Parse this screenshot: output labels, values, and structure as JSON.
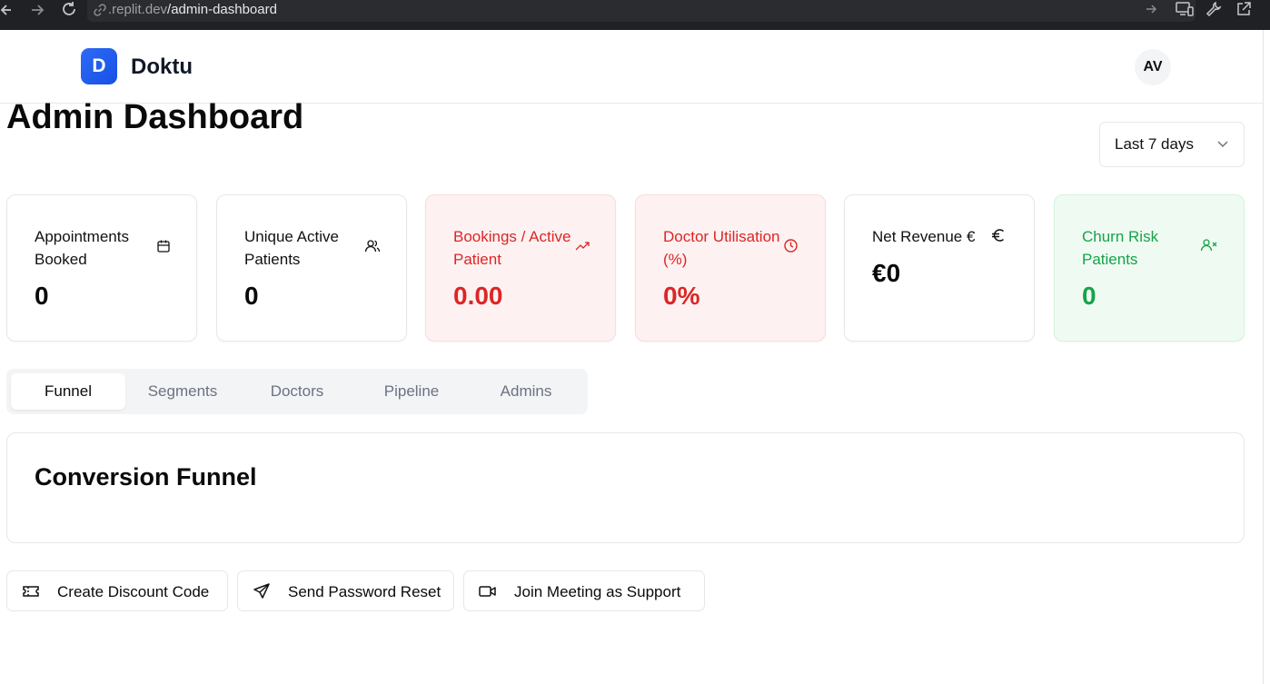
{
  "browser": {
    "url_host": ".replit.dev",
    "url_path": "/admin-dashboard",
    "icons": [
      "back-arrow-icon",
      "forward-arrow-icon",
      "reload-icon",
      "link-icon",
      "go-arrow-icon",
      "devices-icon",
      "wrench-icon",
      "open-external-icon"
    ]
  },
  "header": {
    "logo_letter": "D",
    "brand": "Doktu",
    "avatar_initials": "AV"
  },
  "page": {
    "title": "Admin Dashboard",
    "date_range": "Last 7 days"
  },
  "kpis": [
    {
      "label": "Appointments Booked",
      "value": "0",
      "icon": "calendar-icon",
      "tone": "neutral"
    },
    {
      "label": "Unique Active Patients",
      "value": "0",
      "icon": "users-icon",
      "tone": "neutral"
    },
    {
      "label": "Bookings / Active Patient",
      "value": "0.00",
      "icon": "trending-up-icon",
      "tone": "red"
    },
    {
      "label": "Doctor Utilisation (%)",
      "value": "0%",
      "icon": "clock-icon",
      "tone": "red"
    },
    {
      "label": "Net Revenue €",
      "value": "€0",
      "icon": "euro-icon",
      "tone": "neutral"
    },
    {
      "label": "Churn Risk Patients",
      "value": "0",
      "icon": "user-x-icon",
      "tone": "green"
    }
  ],
  "tabs": [
    {
      "label": "Funnel",
      "active": true
    },
    {
      "label": "Segments",
      "active": false
    },
    {
      "label": "Doctors",
      "active": false
    },
    {
      "label": "Pipeline",
      "active": false
    },
    {
      "label": "Admins",
      "active": false
    }
  ],
  "panel": {
    "title": "Conversion Funnel"
  },
  "actions": [
    {
      "label": "Create Discount Code",
      "icon": "ticket-icon"
    },
    {
      "label": "Send Password Reset",
      "icon": "send-icon"
    },
    {
      "label": "Join Meeting as Support",
      "icon": "video-icon"
    }
  ],
  "colors": {
    "brand": "#1a5cf0",
    "alert_red": "#dc2626",
    "alert_red_bg": "#fef1f1",
    "success_green": "#16a34a",
    "success_green_bg": "#effbf2"
  }
}
